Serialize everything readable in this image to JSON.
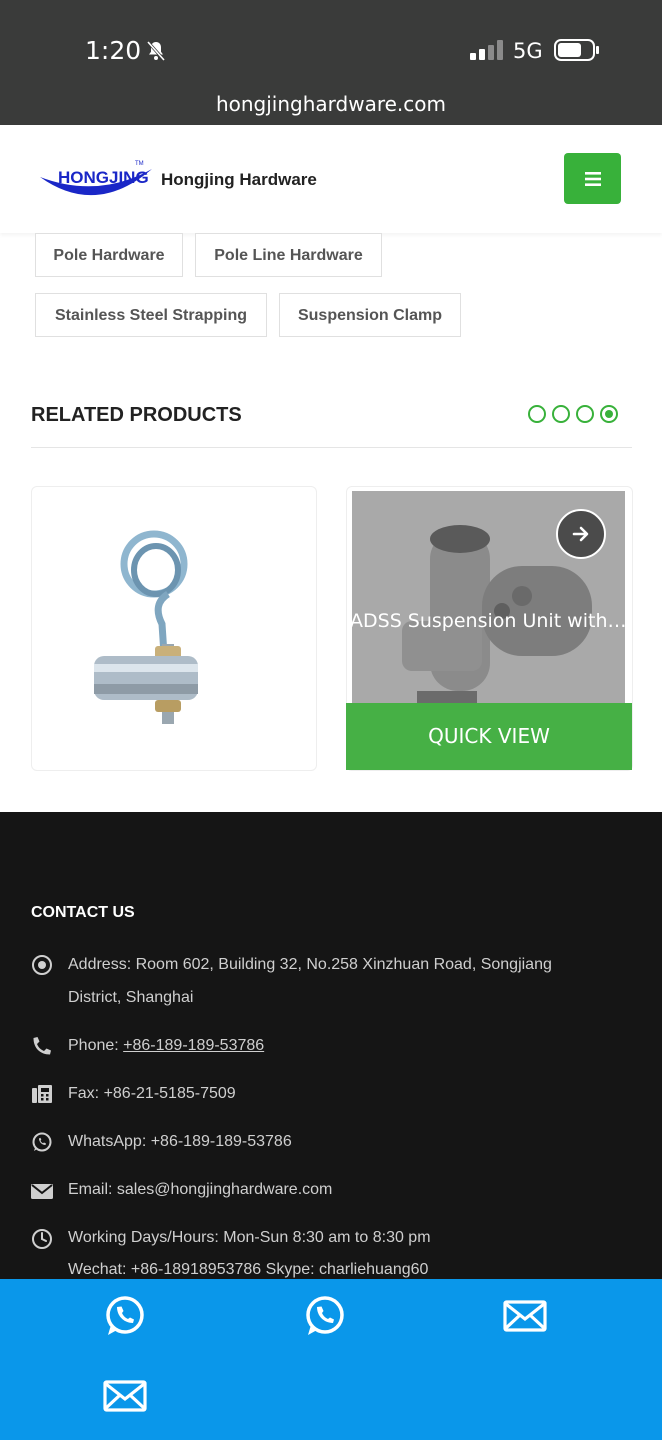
{
  "status_bar": {
    "time": "1:20",
    "network": "5G"
  },
  "browser": {
    "url": "hongjinghardware.com"
  },
  "header": {
    "logo_text": "HONGJING",
    "logo_tm": "TM",
    "brand": "Hongjing Hardware"
  },
  "tags": [
    "Pole Hardware",
    "Pole Line Hardware",
    "Stainless Steel Strapping",
    "Suspension Clamp"
  ],
  "related": {
    "title": "RELATED PRODUCTS",
    "carousel_dots": 4,
    "active_dot": 4,
    "products": [
      {
        "name": ""
      },
      {
        "name": "ADSS Suspension Unit with ...",
        "cta": "QUICK VIEW"
      }
    ]
  },
  "contact": {
    "title": "CONTACT US",
    "address_line1": "Address: Room 602, Building 32, No.258 Xinzhuan Road, Songjiang",
    "address_line2": "District, Shanghai",
    "phone_label": "Phone: ",
    "phone": "+86-189-189-53786",
    "fax": "Fax: +86-21-5185-7509",
    "whatsapp": "WhatsApp: +86-189-189-53786",
    "email": "Email: sales@hongjinghardware.com",
    "hours": "Working Days/Hours: Mon-Sun 8:30 am to 8:30 pm",
    "wechat": "Wechat: +86-18918953786 Skype: charliehuang60"
  },
  "colors": {
    "green": "#38b13a",
    "footer_bg": "#151515",
    "bottom_bar": "#0a97ea"
  }
}
